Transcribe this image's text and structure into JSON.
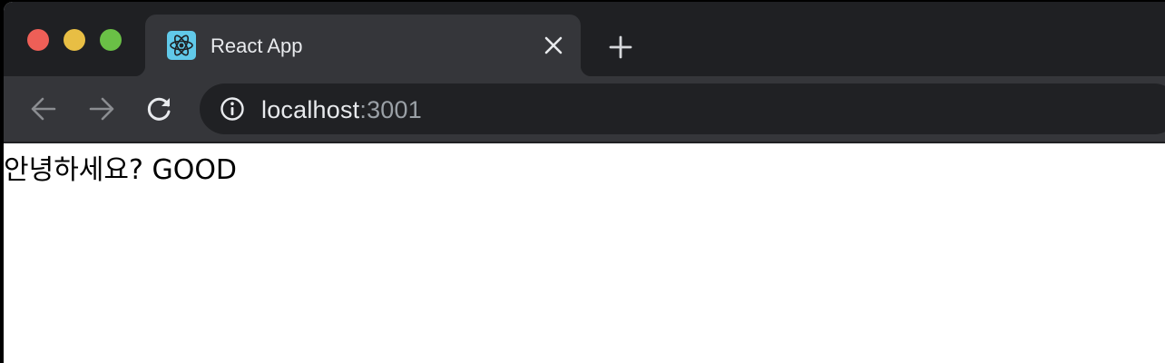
{
  "window": {
    "traffic_lights": {
      "close_color": "#ee5f57",
      "minimize_color": "#e8be44",
      "maximize_color": "#6ac046"
    }
  },
  "tabs": [
    {
      "title": "React App",
      "favicon": "react-logo-icon",
      "favicon_color": "#61c9e9",
      "active": true,
      "close_icon": "close-icon"
    }
  ],
  "new_tab_icon": "plus-icon",
  "toolbar": {
    "back_icon": "arrow-left-icon",
    "forward_icon": "arrow-right-icon",
    "reload_icon": "reload-icon",
    "site_info_icon": "info-circle-icon",
    "address": {
      "host": "localhost",
      "port": ":3001"
    }
  },
  "page": {
    "text": "안녕하세요? GOOD"
  }
}
